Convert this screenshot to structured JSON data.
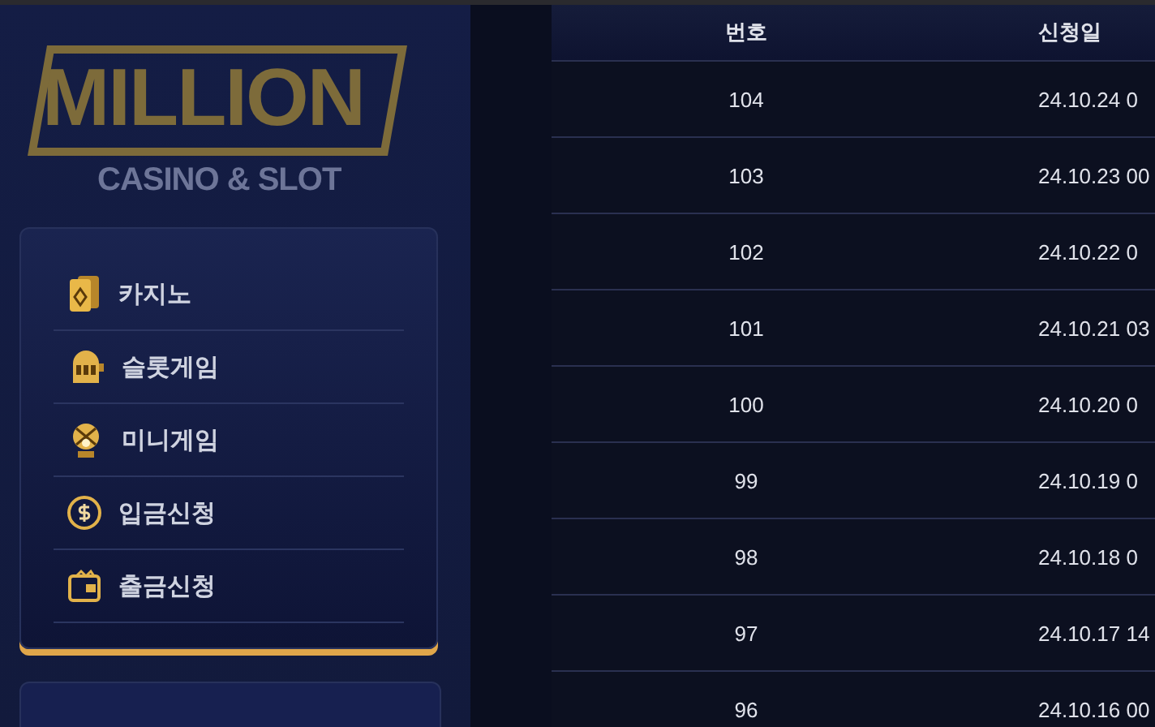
{
  "logo": {
    "wordmark": "MILLION",
    "tagline": "CASINO & SLOT"
  },
  "menu": [
    {
      "label": "카지노",
      "kind": "cards"
    },
    {
      "label": "슬롯게임",
      "kind": "slot"
    },
    {
      "label": "미니게임",
      "kind": "lottery"
    },
    {
      "label": "입금신청",
      "kind": "coin"
    },
    {
      "label": "출금신청",
      "kind": "wallet"
    }
  ],
  "table": {
    "columns": [
      "번호",
      "신청일"
    ],
    "rows": [
      [
        "104",
        "24.10.24 0"
      ],
      [
        "103",
        "24.10.23 00"
      ],
      [
        "102",
        "24.10.22 0"
      ],
      [
        "101",
        "24.10.21 03"
      ],
      [
        "100",
        "24.10.20 0"
      ],
      [
        "99",
        "24.10.19 0"
      ],
      [
        "98",
        "24.10.18 0"
      ],
      [
        "97",
        "24.10.17 14"
      ],
      [
        "96",
        "24.10.16 00"
      ]
    ]
  }
}
